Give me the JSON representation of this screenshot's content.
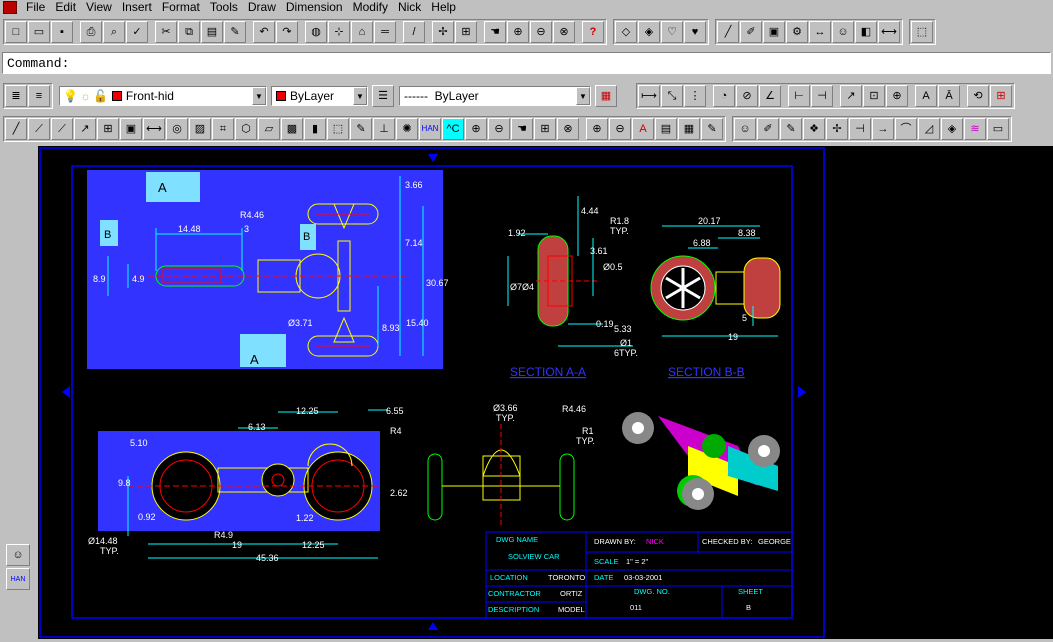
{
  "menu": {
    "items": [
      "File",
      "Edit",
      "View",
      "Insert",
      "Format",
      "Tools",
      "Draw",
      "Dimension",
      "Modify",
      "Nick",
      "Help"
    ]
  },
  "command": {
    "label": "Command:"
  },
  "properties": {
    "layer": "Front-hid",
    "color": "ByLayer",
    "linetype": "------  ByLayer",
    "color_swatch": "#e00000"
  },
  "drawing": {
    "dims_top_left": [
      "14.48",
      "R4.46",
      "3.66",
      "7.14",
      "30.67",
      "8.9",
      "4.9",
      "3",
      "Ø3.71",
      "8.93",
      "15.40"
    ],
    "section_a_label": "A",
    "section_b_label": "B",
    "dims_section_a": [
      "4.44",
      "R1.8",
      "TYP.",
      "1.92",
      "3.61",
      "Ø0.5",
      "Ø7",
      "Ø4",
      "0.19",
      "5.33",
      "Ø1",
      "6TYP."
    ],
    "dims_section_b": [
      "20.17",
      "8.38",
      "6.88",
      "5",
      "19"
    ],
    "section_titles": [
      "SECTION A-A",
      "SECTION B-B"
    ],
    "dims_bottom_left": [
      "6.13",
      "12.25",
      "6.55",
      "R4",
      "5.10",
      "9.8",
      "0.92",
      "2.62",
      "1.22",
      "R4.9",
      "19",
      "12.25",
      "45.36",
      "Ø14.48",
      "TYP."
    ],
    "dims_bottom_mid": [
      "Ø3.66",
      "TYP.",
      "R4.46",
      "R1",
      "TYP."
    ]
  },
  "title_block": {
    "dwg_name_label": "DWG NAME",
    "dwg_name": "SOLVIEW CAR",
    "drawn_by_label": "DRAWN BY:",
    "drawn_by": "NICK",
    "checked_by_label": "CHECKED BY:",
    "checked_by": "GEORGE",
    "scale_label": "SCALE",
    "scale": "1\" = 2\"",
    "location_label": "LOCATION",
    "location": "TORONTO",
    "date_label": "DATE",
    "date": "03-03-2001",
    "contractor_label": "CONTRACTOR",
    "contractor": "ORTIZ",
    "dwg_no_label": "DWG. NO.",
    "dwg_no": "011",
    "description_label": "DESCRIPTION",
    "description": "MODEL",
    "sheet_label": "SHEET",
    "sheet": "B"
  },
  "colors": {
    "canvas": "#000000",
    "border": "#0000ff",
    "viewport": "#3333ff",
    "dim": "#00ffff",
    "geometry": "#ffff00",
    "hidden": "#ff0000",
    "green": "#00ff00"
  }
}
